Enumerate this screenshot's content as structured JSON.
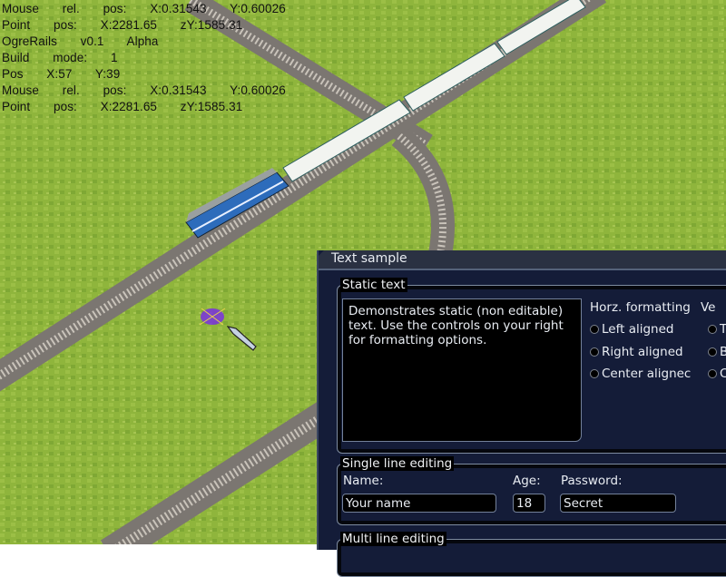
{
  "debug_overlay": {
    "lines": [
      "Mouse  rel.  pos:  X:0.31543  Y:0.60026",
      "Point  pos:  X:2281.65  zY:1585.31",
      "OgreRails  v0.1  Alpha",
      "Build  mode:  1",
      "Pos  X:57  Y:39",
      "Mouse  rel.  pos:  X:0.31543  Y:0.60026",
      "Point  pos:  X:2281.65  zY:1585.31"
    ]
  },
  "window": {
    "title": "Text sample",
    "static_group": {
      "legend": "Static text",
      "text": "Demonstrates static (non editable) text. Use the controls on your right for formatting options.",
      "horz_formatting": {
        "heading": "Horz. formatting",
        "options": [
          "Left aligned",
          "Right aligned",
          "Center alignec"
        ]
      },
      "vert_formatting": {
        "heading": "Ve",
        "options": [
          "T",
          "B",
          "C"
        ]
      }
    },
    "single_line_group": {
      "legend": "Single line editing",
      "name_label": "Name:",
      "name_value": "Your name",
      "age_label": "Age:",
      "age_value": "18",
      "password_label": "Password:",
      "password_value": "Secret"
    },
    "multi_line_group": {
      "legend": "Multi line editing"
    }
  },
  "colors": {
    "grass": "#8db43a",
    "track_bed": "#7a7570",
    "window_bg": "#141c38"
  }
}
